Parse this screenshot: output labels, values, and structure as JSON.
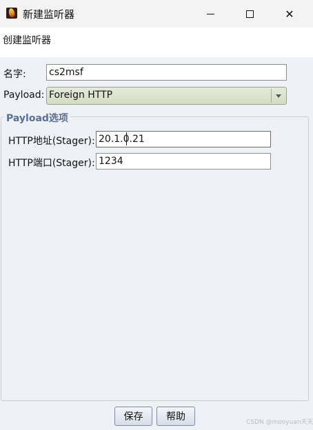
{
  "window": {
    "title": "新建监听器",
    "icon": "flame-app-icon",
    "controls": {
      "minimize": "minimize-icon",
      "maximize": "maximize-icon",
      "close": "✕"
    }
  },
  "header": {
    "text": "创建监听器"
  },
  "form": {
    "name_label": "名字:",
    "name_value": "cs2msf",
    "payload_label": "Payload:",
    "payload_value": "Foreign HTTP",
    "options_title": "Payload选项",
    "host_label": "HTTP地址(Stager):",
    "host_value": "20.1.0.21",
    "port_label": "HTTP端口(Stager):",
    "port_value": "1234"
  },
  "buttons": {
    "save": "保存",
    "help": "帮助"
  },
  "watermark": "CSDN @mooyuan天天",
  "colors": {
    "group_title": "#5a6f94",
    "combo_bg": "#dde2cc",
    "panel_bg": "#eef1f6"
  }
}
